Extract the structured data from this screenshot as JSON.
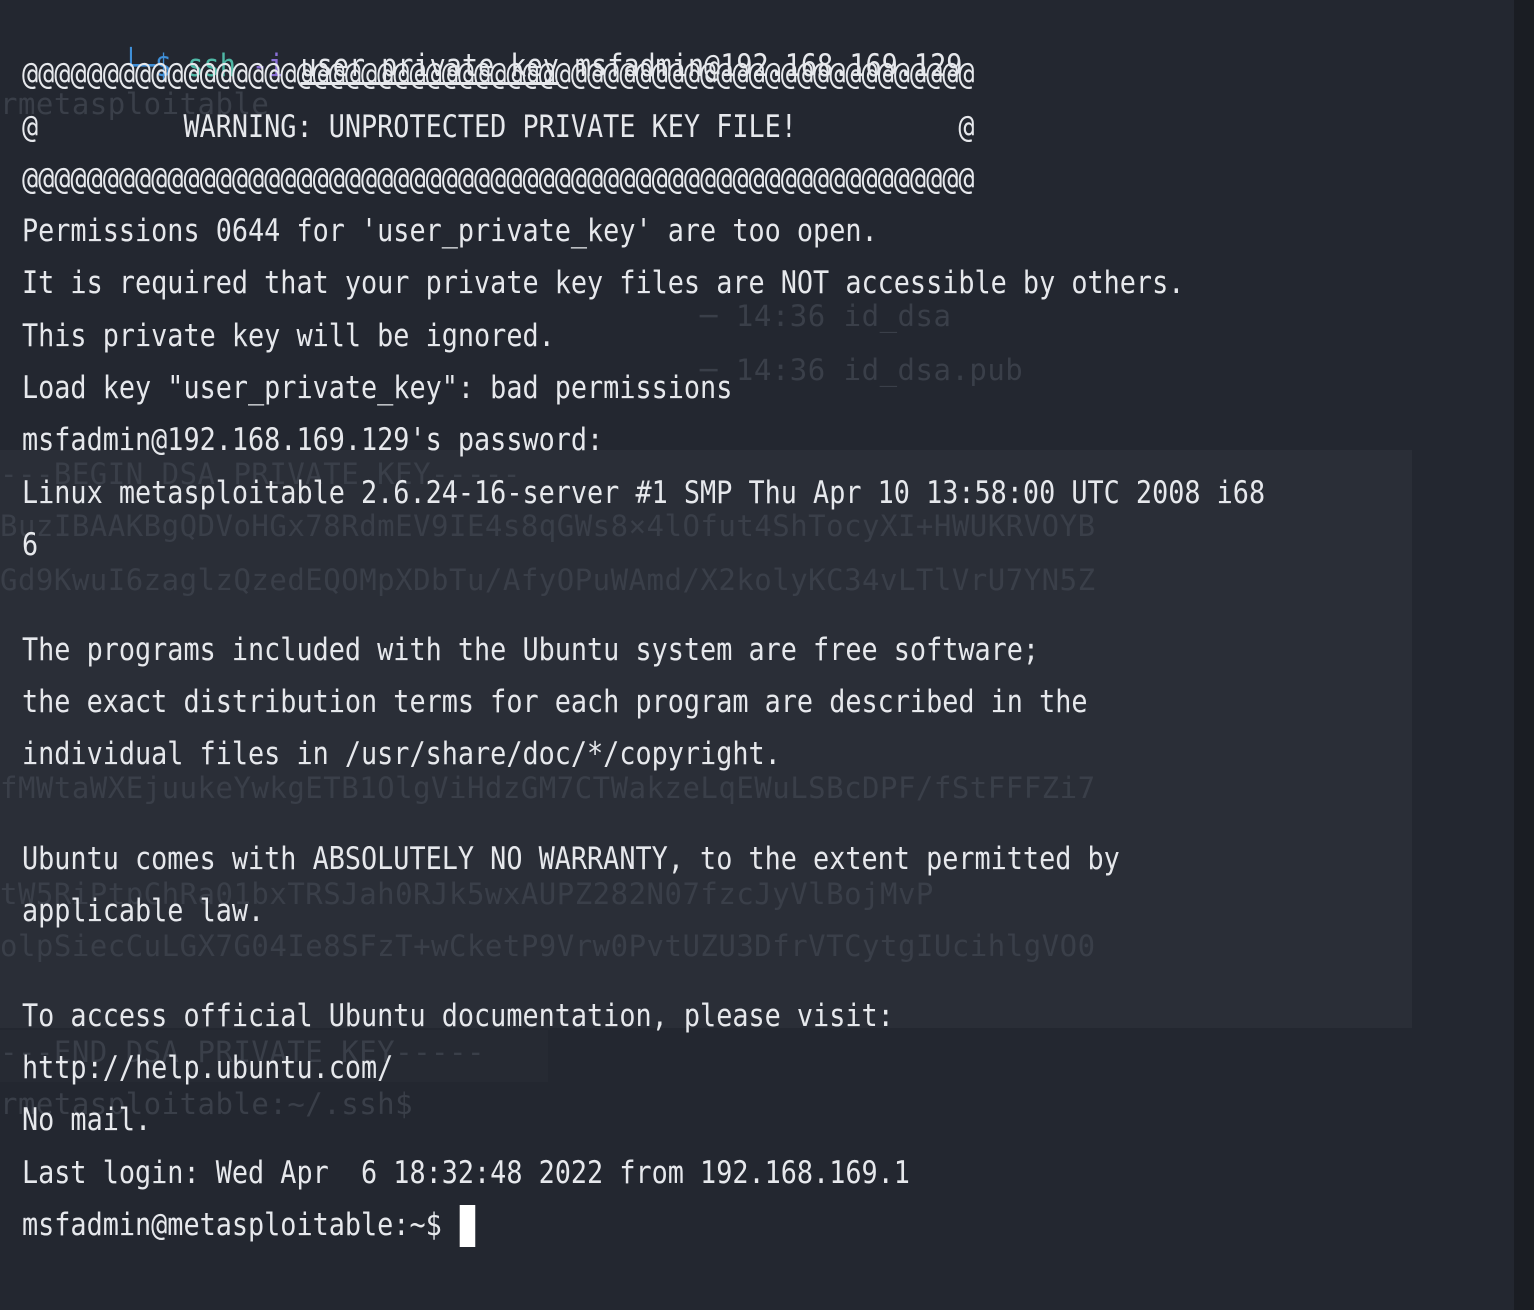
{
  "colors": {
    "background": "#232730",
    "text": "#e6e8ec",
    "prompt_accent": "#3f8fd8",
    "command": "#4fb8a6",
    "flag": "#8a6fd6"
  },
  "command_line": {
    "corner": "└─",
    "dollar": "$",
    "command": "ssh",
    "flag": "-i",
    "key_arg": "user_private_key",
    "target": "msfadmin@192.168.169.129"
  },
  "output_lines": [
    "@@@@@@@@@@@@@@@@@@@@@@@@@@@@@@@@@@@@@@@@@@@@@@@@@@@@@@@@@@@",
    "@         WARNING: UNPROTECTED PRIVATE KEY FILE!          @",
    "@@@@@@@@@@@@@@@@@@@@@@@@@@@@@@@@@@@@@@@@@@@@@@@@@@@@@@@@@@@",
    "Permissions 0644 for 'user_private_key' are too open.",
    "It is required that your private key files are NOT accessible by others.",
    "This private key will be ignored.",
    "Load key \"user_private_key\": bad permissions",
    "msfadmin@192.168.169.129's password:",
    "Linux metasploitable 2.6.24-16-server #1 SMP Thu Apr 10 13:58:00 UTC 2008 i68",
    "6",
    "",
    "The programs included with the Ubuntu system are free software;",
    "the exact distribution terms for each program are described in the",
    "individual files in /usr/share/doc/*/copyright.",
    "",
    "Ubuntu comes with ABSOLUTELY NO WARRANTY, to the extent permitted by",
    "applicable law.",
    "",
    "To access official Ubuntu documentation, please visit:",
    "http://help.ubuntu.com/",
    "No mail.",
    "Last login: Wed Apr  6 18:32:48 2022 from 192.168.169.1"
  ],
  "final_prompt": "msfadmin@metasploitable:~$ ",
  "ghost_lines": [
    "rmetasploitable",
    "─ 14:36 id_dsa",
    "─ 14:36 id_dsa.pub",
    "---BEGIN DSA PRIVATE KEY-----",
    "BuzIBAAKBgQDVoHGx78RdmEV9IE4s8qGWs8×4lOfut4ShTocyXI+HWUKRVOYB",
    "Gd9KwuI6zaglzQzedEQOMpXDbTu/AfyOPuWAmd/X2kolyKC34vLTlVrU7YN5Z",
    "fMWtaWXEjuukeYwkgETB1OlgViHdzGM7CTWakzeLqEWuLSBcDPF/fStFFFZi7",
    "tW5RiPtpChRa01bxTRSJah0RJk5wxAUPZ282N07fzcJyVlBojMvP",
    "olpSiecCuLGX7G04Ie8SFzT+wCketP9Vrw0PvtUZU3DfrVTCytgIUcihlgVO0",
    "---END DSA PRIVATE KEY-----",
    "rmetasploitable:~/.ssh$"
  ]
}
